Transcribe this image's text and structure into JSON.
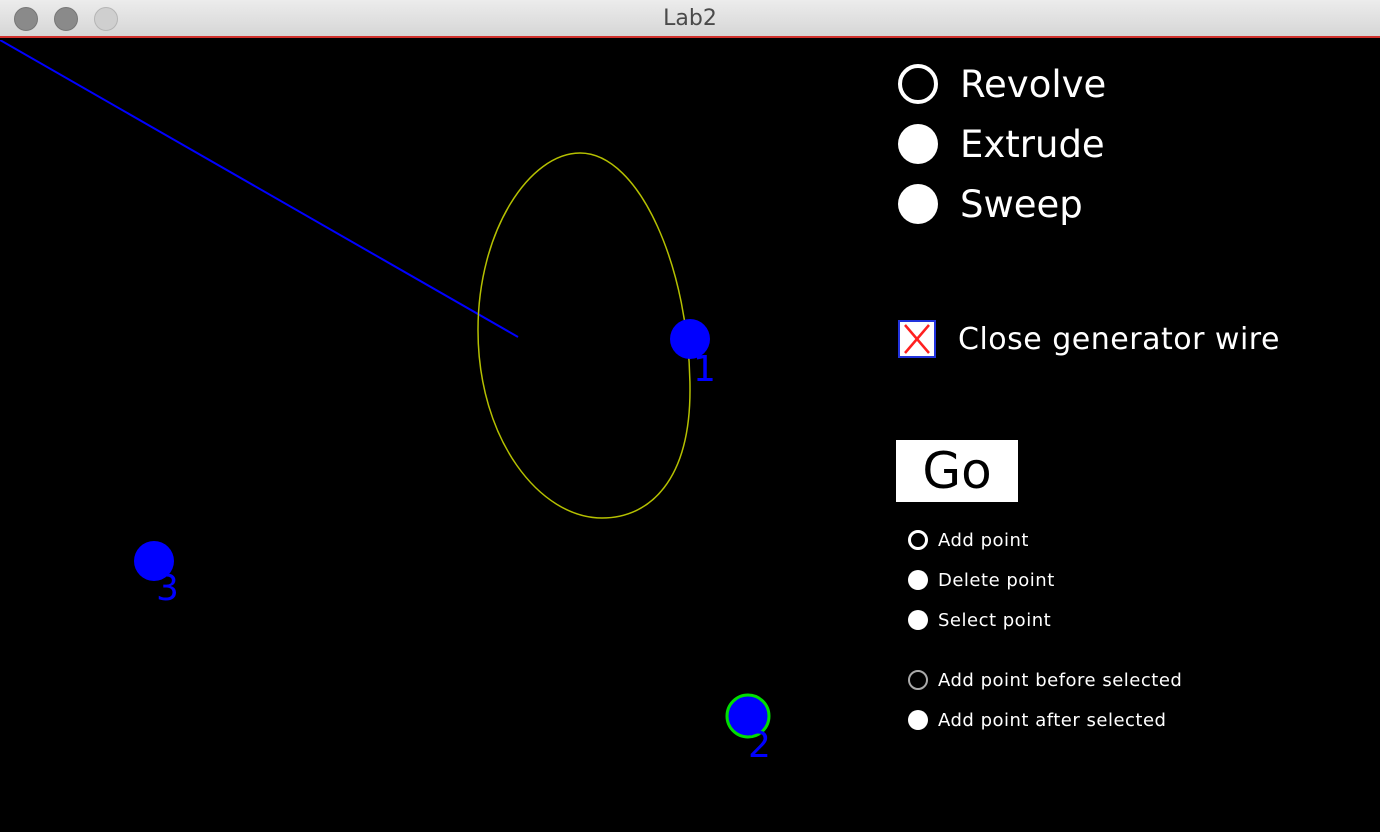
{
  "window": {
    "title": "Lab2"
  },
  "canvas": {
    "points": [
      {
        "label": "1",
        "selected": false
      },
      {
        "label": "2",
        "selected": true
      },
      {
        "label": "3",
        "selected": false
      }
    ],
    "colors": {
      "point": "#0000ff",
      "selected_ring": "#00dd00",
      "ellipse": "#b5c000",
      "line": "#0000ff"
    }
  },
  "panel": {
    "surface_modes": [
      {
        "label": "Revolve",
        "selected": true
      },
      {
        "label": "Extrude",
        "selected": false
      },
      {
        "label": "Sweep",
        "selected": false
      }
    ],
    "close_wire": {
      "label": "Close generator wire",
      "checked": true
    },
    "go_label": "Go",
    "edit_modes": [
      {
        "label": "Add point",
        "selected": true
      },
      {
        "label": "Delete point",
        "selected": false
      },
      {
        "label": "Select point",
        "selected": false
      }
    ],
    "insert_modes": [
      {
        "label": "Add point before selected",
        "selected": true
      },
      {
        "label": "Add point after selected",
        "selected": false
      }
    ]
  }
}
